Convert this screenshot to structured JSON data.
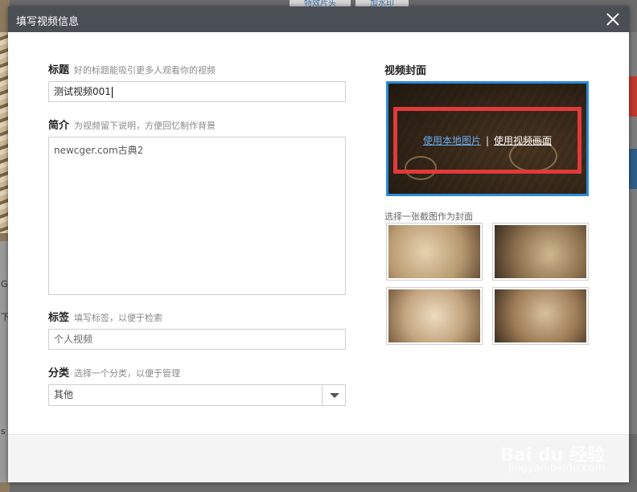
{
  "background": {
    "tabs": [
      "特效片头",
      "加水印"
    ],
    "left_marks": [
      "G",
      "下",
      "s"
    ]
  },
  "modal": {
    "title": "填写视频信息"
  },
  "form": {
    "title": {
      "label": "标题",
      "hint": "好的标题能吸引更多人观看你的视频",
      "value": "测试视频001"
    },
    "description": {
      "label": "简介",
      "hint": "为视频留下说明，方便回忆制作背景",
      "value": "newcger.com古典2"
    },
    "tags": {
      "label": "标签",
      "hint": "填写标签，以便于检索",
      "placeholder": "个人视频"
    },
    "category": {
      "label": "分类",
      "hint": "选择一个分类，以便于管理",
      "selected": "其他"
    }
  },
  "cover": {
    "heading": "视频封面",
    "use_local_image": "使用本地图片",
    "separator": "|",
    "use_video_frame": "使用视频画面",
    "thumbs_label": "选择一张截图作为封面",
    "highlight_color": "#e03a3a",
    "selected_border_color": "#2d8ad8"
  },
  "watermark": {
    "main": "Bai du 经验",
    "sub": "jingyan.baidu.com"
  },
  "colors": {
    "header_bg": "#4a4f56",
    "link_blue": "#6aaef0"
  }
}
